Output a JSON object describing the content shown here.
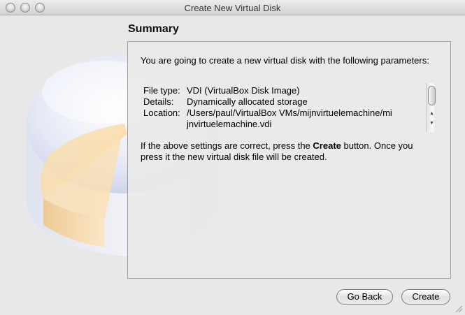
{
  "window": {
    "title": "Create New Virtual Disk"
  },
  "summary": {
    "heading": "Summary",
    "intro": "You are going to create a new virtual disk with the following parameters:",
    "params": [
      {
        "label": "File type:",
        "value": "VDI (VirtualBox Disk Image)"
      },
      {
        "label": "Details:",
        "value": "Dynamically allocated storage"
      },
      {
        "label": "Location:",
        "value": "/Users/paul/VirtualBox VMs/mijnvirtuelemachine/mi"
      },
      {
        "label": "",
        "value": "jnvirtuelemachine.vdi"
      }
    ],
    "confirm_prefix": "If the above settings are correct, press the ",
    "confirm_bold": "Create",
    "confirm_suffix": " button. Once you press it the new virtual disk file will be created."
  },
  "buttons": {
    "back_label": "Go Back",
    "create_label": "Create"
  },
  "colors": {
    "window_bg": "#e8e8e8",
    "panel_border": "#9a9a9a",
    "pie_accent": "#f6c97a"
  },
  "icons": [
    "close-icon",
    "minimize-icon",
    "zoom-icon",
    "scroll-up-icon",
    "scroll-down-icon",
    "resize-grip-icon",
    "disk-artwork"
  ]
}
